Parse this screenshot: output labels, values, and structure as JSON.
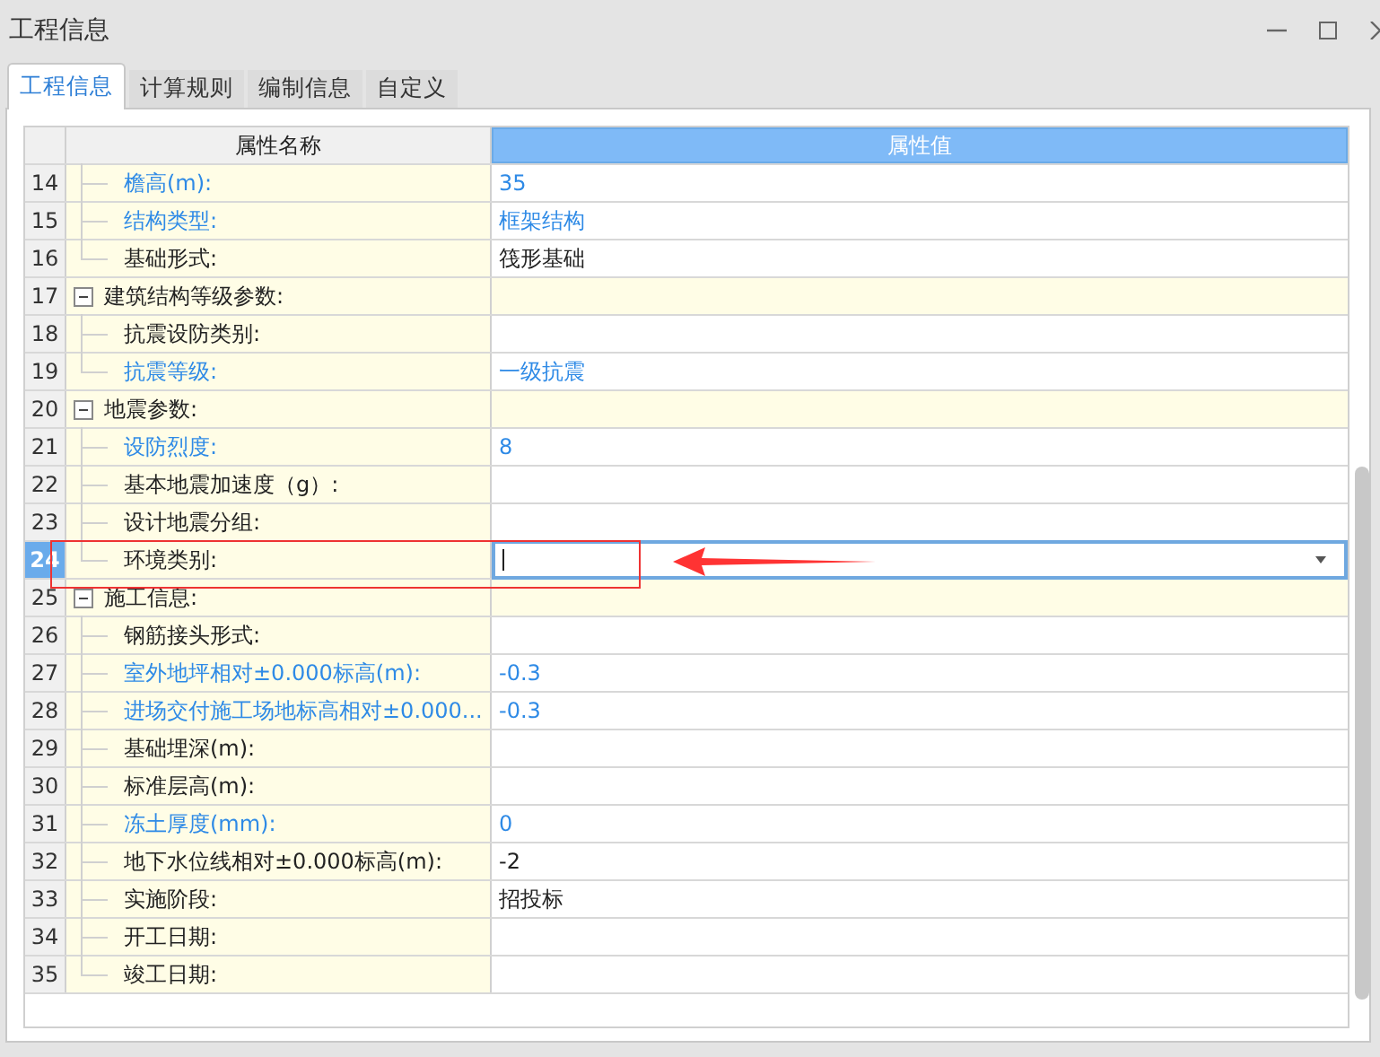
{
  "window": {
    "title": "工程信息"
  },
  "tabs": [
    {
      "label": "工程信息",
      "selected": true
    },
    {
      "label": "计算规则",
      "selected": false
    },
    {
      "label": "编制信息",
      "selected": false
    },
    {
      "label": "自定义",
      "selected": false
    }
  ],
  "table": {
    "columns": [
      {
        "label": "属性名称",
        "selected": false
      },
      {
        "label": "属性值",
        "selected": true
      }
    ],
    "rows": [
      {
        "kind": "item",
        "number": "14",
        "name": "檐高(m):",
        "value": "35",
        "emphasized": true,
        "selected": false
      },
      {
        "kind": "item",
        "number": "15",
        "name": "结构类型:",
        "value": "框架结构",
        "emphasized": true,
        "selected": false
      },
      {
        "kind": "item",
        "number": "16",
        "name": "基础形式:",
        "value": "筏形基础",
        "emphasized": false,
        "selected": false
      },
      {
        "kind": "group",
        "number": "17",
        "name": "建筑结构等级参数:",
        "expanded": true,
        "selected": false,
        "children": [
          {
            "kind": "item",
            "number": "18",
            "name": "抗震设防类别:",
            "emphasized": false,
            "selected": false
          },
          {
            "kind": "item",
            "number": "19",
            "name": "抗震等级:",
            "value": "一级抗震",
            "emphasized": true,
            "selected": false
          }
        ]
      },
      {
        "kind": "group",
        "number": "20",
        "name": "地震参数:",
        "expanded": true,
        "selected": false,
        "children": [
          {
            "kind": "item",
            "number": "21",
            "name": "设防烈度:",
            "value": "8",
            "emphasized": true,
            "selected": false
          },
          {
            "kind": "item",
            "number": "22",
            "name": "基本地震加速度（g）:",
            "emphasized": false,
            "selected": false
          },
          {
            "kind": "item",
            "number": "23",
            "name": "设计地震分组:",
            "emphasized": false,
            "selected": false
          },
          {
            "kind": "item",
            "number": "24",
            "name": "环境类别:",
            "emphasized": false,
            "selected": true
          }
        ]
      },
      {
        "kind": "group",
        "number": "25",
        "name": "施工信息:",
        "expanded": true,
        "selected": false,
        "children": [
          {
            "kind": "item",
            "number": "26",
            "name": "钢筋接头形式:",
            "emphasized": false,
            "selected": false
          },
          {
            "kind": "item",
            "number": "27",
            "name": "室外地坪相对±0.000标高(m):",
            "value": "-0.3",
            "emphasized": true,
            "selected": false
          },
          {
            "kind": "item",
            "number": "28",
            "name": "进场交付施工场地标高相对±0.000...",
            "value": "-0.3",
            "emphasized": true,
            "selected": false
          },
          {
            "kind": "item",
            "number": "29",
            "name": "基础埋深(m):",
            "emphasized": false,
            "selected": false
          },
          {
            "kind": "item",
            "number": "30",
            "name": "标准层高(m):",
            "emphasized": false,
            "selected": false
          },
          {
            "kind": "item",
            "number": "31",
            "name": "冻土厚度(mm):",
            "value": "0",
            "emphasized": true,
            "selected": false
          },
          {
            "kind": "item",
            "number": "32",
            "name": "地下水位线相对±0.000标高(m):",
            "value": "-2",
            "emphasized": false,
            "selected": false
          },
          {
            "kind": "item",
            "number": "33",
            "name": "实施阶段:",
            "value": "招投标",
            "emphasized": false,
            "selected": false
          },
          {
            "kind": "item",
            "number": "34",
            "name": "开工日期:",
            "emphasized": false,
            "selected": false
          },
          {
            "kind": "item",
            "number": "35",
            "name": "竣工日期:",
            "emphasized": false,
            "selected": false
          }
        ]
      }
    ]
  }
}
